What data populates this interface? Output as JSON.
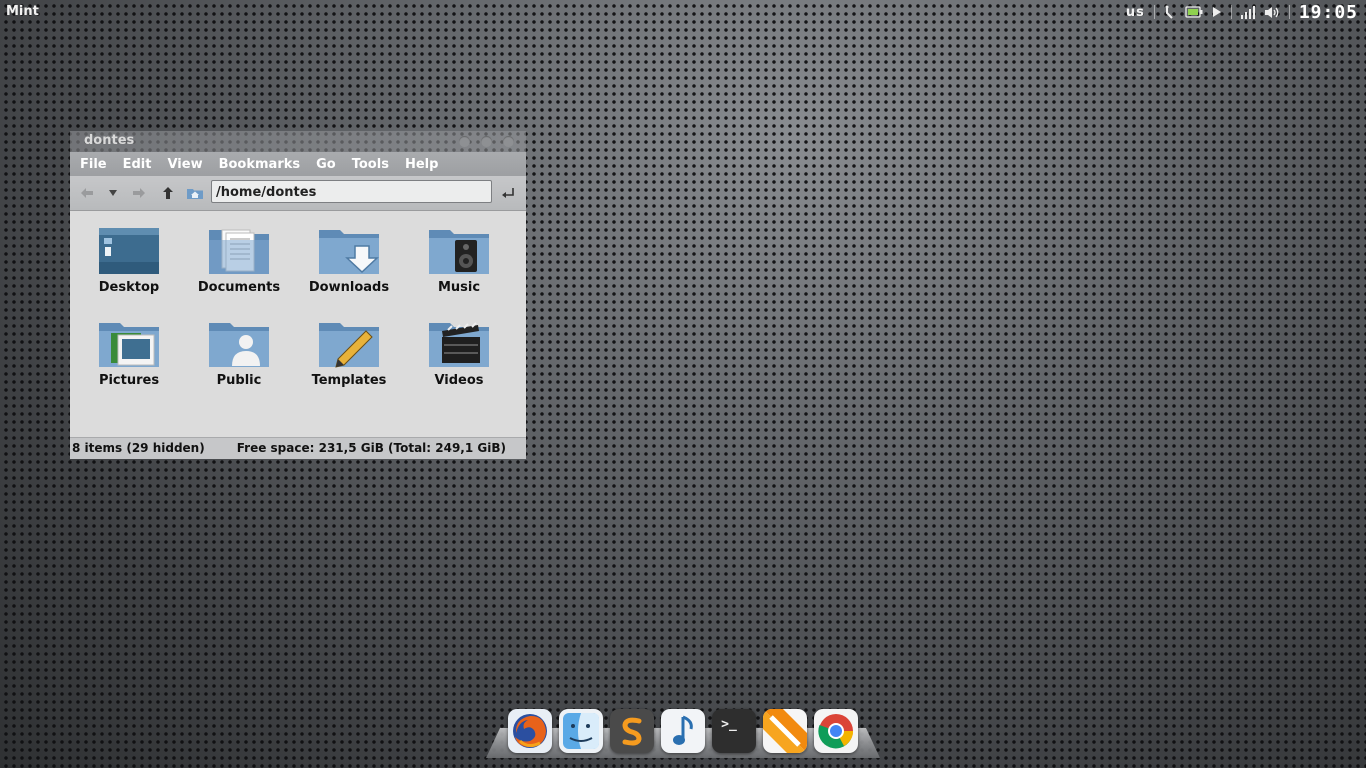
{
  "panel": {
    "menu_label": "Mint",
    "keyboard_layout": "us",
    "clock": "19:05",
    "tray_icons": [
      "network-icon",
      "battery-icon",
      "media-play-icon",
      "signal-icon",
      "volume-icon"
    ]
  },
  "window": {
    "title": "dontes",
    "menu": [
      "File",
      "Edit",
      "View",
      "Bookmarks",
      "Go",
      "Tools",
      "Help"
    ],
    "toolbar": {
      "back_icon": "arrow-left-icon",
      "history_icon": "chevron-down-icon",
      "forward_icon": "arrow-right-icon",
      "up_icon": "arrow-up-icon",
      "home_icon": "home-icon",
      "path": "/home/dontes",
      "go_icon": "enter-icon"
    },
    "items": [
      {
        "label": "Desktop",
        "icon": "desktop-folder-icon"
      },
      {
        "label": "Documents",
        "icon": "documents-folder-icon"
      },
      {
        "label": "Downloads",
        "icon": "downloads-folder-icon"
      },
      {
        "label": "Music",
        "icon": "music-folder-icon"
      },
      {
        "label": "Pictures",
        "icon": "pictures-folder-icon"
      },
      {
        "label": "Public",
        "icon": "public-folder-icon"
      },
      {
        "label": "Templates",
        "icon": "templates-folder-icon"
      },
      {
        "label": "Videos",
        "icon": "videos-folder-icon"
      }
    ],
    "status": {
      "left": "8 items (29 hidden)",
      "right": "Free space: 231,5 GiB (Total: 249,1 GiB)"
    },
    "colors": {
      "folder": "#7fa8cf",
      "folder_dark": "#5f8bb6"
    }
  },
  "dock": {
    "apps": [
      {
        "name": "Firefox",
        "icon": "firefox-icon"
      },
      {
        "name": "Finder",
        "icon": "finder-icon"
      },
      {
        "name": "Sublime Text",
        "icon": "sublime-text-icon"
      },
      {
        "name": "Music Player",
        "icon": "music-note-icon"
      },
      {
        "name": "Terminal",
        "icon": "terminal-icon",
        "glyph": ">_"
      },
      {
        "name": "VLC",
        "icon": "vlc-icon"
      },
      {
        "name": "Chrome",
        "icon": "chrome-icon"
      }
    ]
  }
}
